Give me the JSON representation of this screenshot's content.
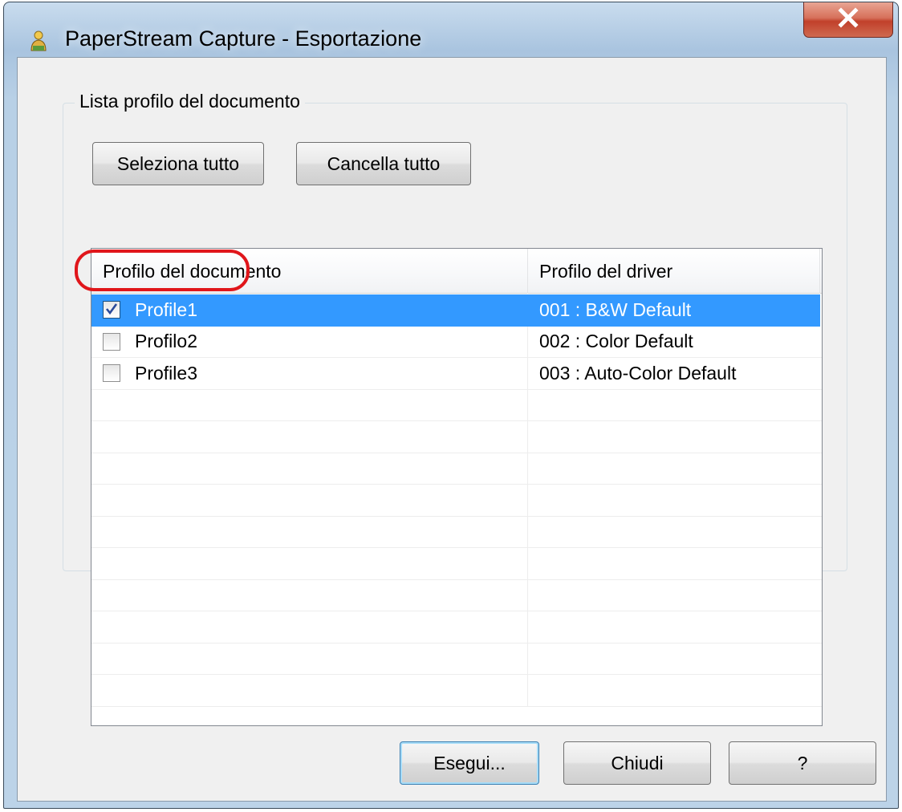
{
  "window": {
    "title": "PaperStream Capture - Esportazione",
    "close_label": "X"
  },
  "group": {
    "label": "Lista profilo del documento",
    "select_all_label": "Seleziona tutto",
    "clear_all_label": "Cancella tutto"
  },
  "list": {
    "columns": [
      "Profilo del documento",
      "Profilo del driver"
    ],
    "rows": [
      {
        "name": "Profile1",
        "driver": "001 : B&W Default",
        "checked": true,
        "selected": true
      },
      {
        "name": "Profilo2",
        "driver": "002 : Color Default",
        "checked": false,
        "selected": false
      },
      {
        "name": "Profile3",
        "driver": "003 : Auto-Color Default",
        "checked": false,
        "selected": false
      }
    ],
    "empty_rows": 10
  },
  "footer": {
    "run_label": "Esegui...",
    "close_label": "Chiudi",
    "help_label": "?"
  },
  "colors": {
    "selection": "#3399ff",
    "highlight_ring": "#e0161b",
    "close_button": "#c1402a"
  },
  "icons": {
    "app": "paperstream-app-icon",
    "checkmark": "checkmark-icon",
    "close": "close-icon"
  }
}
